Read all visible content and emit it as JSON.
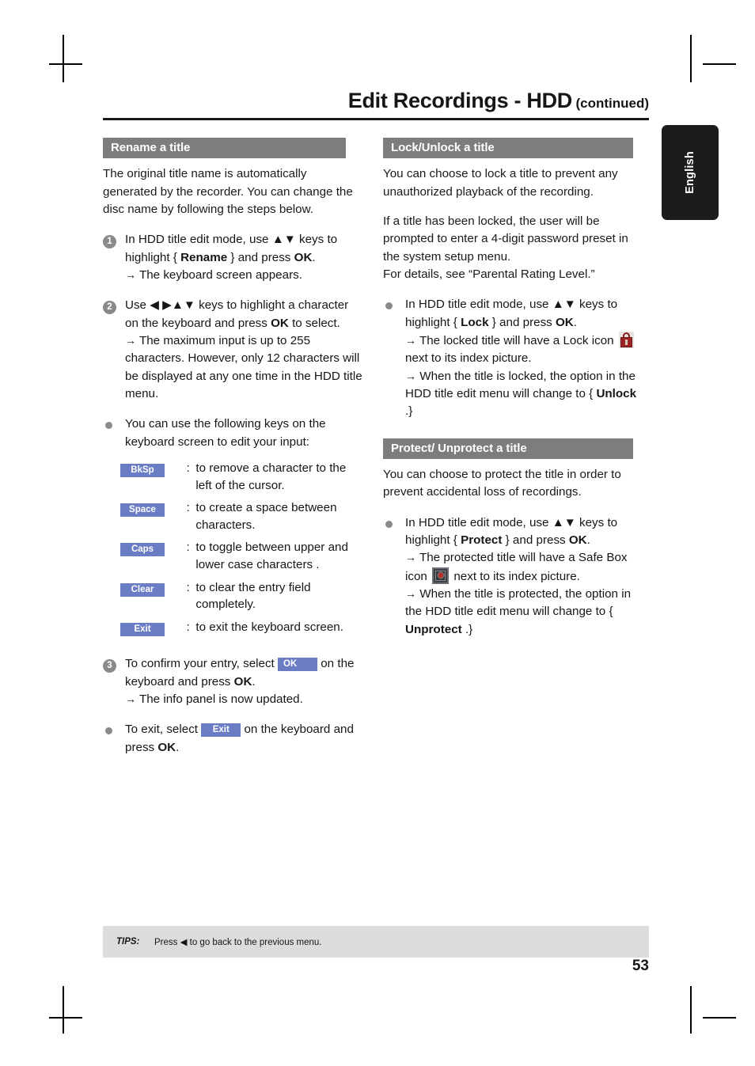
{
  "header": {
    "title": "Edit Recordings - HDD",
    "continued": "(continued)"
  },
  "language_tab": {
    "label": "English"
  },
  "left_column": {
    "section_title": "Rename a title",
    "intro": "The original title name is automatically generated by the recorder. You can change the disc name by following the steps below.",
    "steps": [
      {
        "number": "1",
        "line1_a": "In HDD title edit mode, use ",
        "line1_keys": "▲▼",
        "line1_b": " keys to highlight { ",
        "line1_bold1": "Rename",
        "line1_c": " } and press ",
        "line1_bold2": "OK",
        "line1_d": ".",
        "result_arrow": "→",
        "result": "The keyboard screen appears."
      },
      {
        "number": "2",
        "line1_a": "Use ",
        "line1_keys": "◀ ▶▲▼",
        "line1_b": " keys to highlight a character on the keyboard and press ",
        "line1_bold2": "OK",
        "line1_d": " to select.",
        "result_arrow": "→",
        "result": "The maximum input is up to 255 characters. However, only 12 characters will be displayed at any one time in the HDD title menu."
      }
    ],
    "keys_intro": "You can use the following keys on the keyboard screen to edit your input:",
    "key_legend": [
      {
        "key": "BkSp",
        "colon": ":",
        "desc": "to remove a character to the left of the cursor."
      },
      {
        "key": "Space",
        "colon": ":",
        "desc": "to create a space between characters."
      },
      {
        "key": "Caps",
        "colon": ":",
        "desc": "to toggle between upper and lower case characters ."
      },
      {
        "key": "Clear",
        "colon": ":",
        "desc": "to clear the entry field completely."
      },
      {
        "key": "Exit",
        "colon": ":",
        "desc": "to exit the keyboard screen."
      }
    ],
    "step3": {
      "number": "3",
      "pre": "To confirm your entry, select ",
      "key": "OK",
      "post_a": " on the keyboard and press ",
      "post_bold": "OK",
      "post_b": ".",
      "result_arrow": "→",
      "result": "The info panel is now updated."
    },
    "exit_bullet": {
      "pre": "To exit, select ",
      "key": "Exit",
      "post_a": " on the keyboard and press ",
      "post_bold": "OK",
      "post_b": "."
    }
  },
  "right_column": {
    "lock_section": {
      "section_title": "Lock/Unlock a title",
      "para1": "You can choose to lock a title to prevent any unauthorized playback of the recording.",
      "para2": "If a title has been locked, the user will be prompted to enter a 4-digit password preset in the system setup menu.",
      "para3": "For details, see “Parental Rating Level.”",
      "bullet": {
        "line1_a": "In HDD title edit mode, use ",
        "line1_keys": "▲▼",
        "line1_b": " keys to highlight { ",
        "line1_bold1": "Lock",
        "line1_c": " } and press ",
        "line1_bold2": "OK",
        "line1_d": ".",
        "result1_arrow": "→",
        "result1_a": "The locked title will have a Lock icon",
        "result1_b": "next to its index picture.",
        "result2_arrow": "→",
        "result2_a": "When the title is locked, the option in the HDD title edit menu will change to { ",
        "result2_bold": "Unlock",
        "result2_b": " .}"
      }
    },
    "protect_section": {
      "section_title": "Protect/ Unprotect a title",
      "para1": "You can choose to protect the title in order to prevent accidental loss of recordings.",
      "bullet": {
        "line1_a": "In HDD title edit mode, use ",
        "line1_keys": "▲▼",
        "line1_b": " keys to highlight { ",
        "line1_bold1": "Protect",
        "line1_c": " } and press ",
        "line1_bold2": "OK",
        "line1_d": ".",
        "result1_arrow": "→",
        "result1_a": "The protected title will have a Safe Box icon",
        "result1_b": "next to its index picture.",
        "result2_arrow": "→",
        "result2_a": "When the title is protected, the option in the HDD title edit menu will change to { ",
        "result2_bold": "Unprotect",
        "result2_b": " .}"
      }
    }
  },
  "footer": {
    "tips_label": "TIPS:",
    "tips_pre": "Press ",
    "tips_glyph": "◀",
    "tips_post": " to go back to the previous menu.",
    "page_number": "53"
  },
  "icons": {
    "lock": "lock-icon",
    "safe_box": "safe-box-icon"
  },
  "colors": {
    "section_bar": "#7d7d7d",
    "key_chip": "#6a7cc4",
    "lang_tab": "#1c1c1c",
    "tips_bar": "#dcdcdc",
    "lock_red": "#9c2226"
  }
}
